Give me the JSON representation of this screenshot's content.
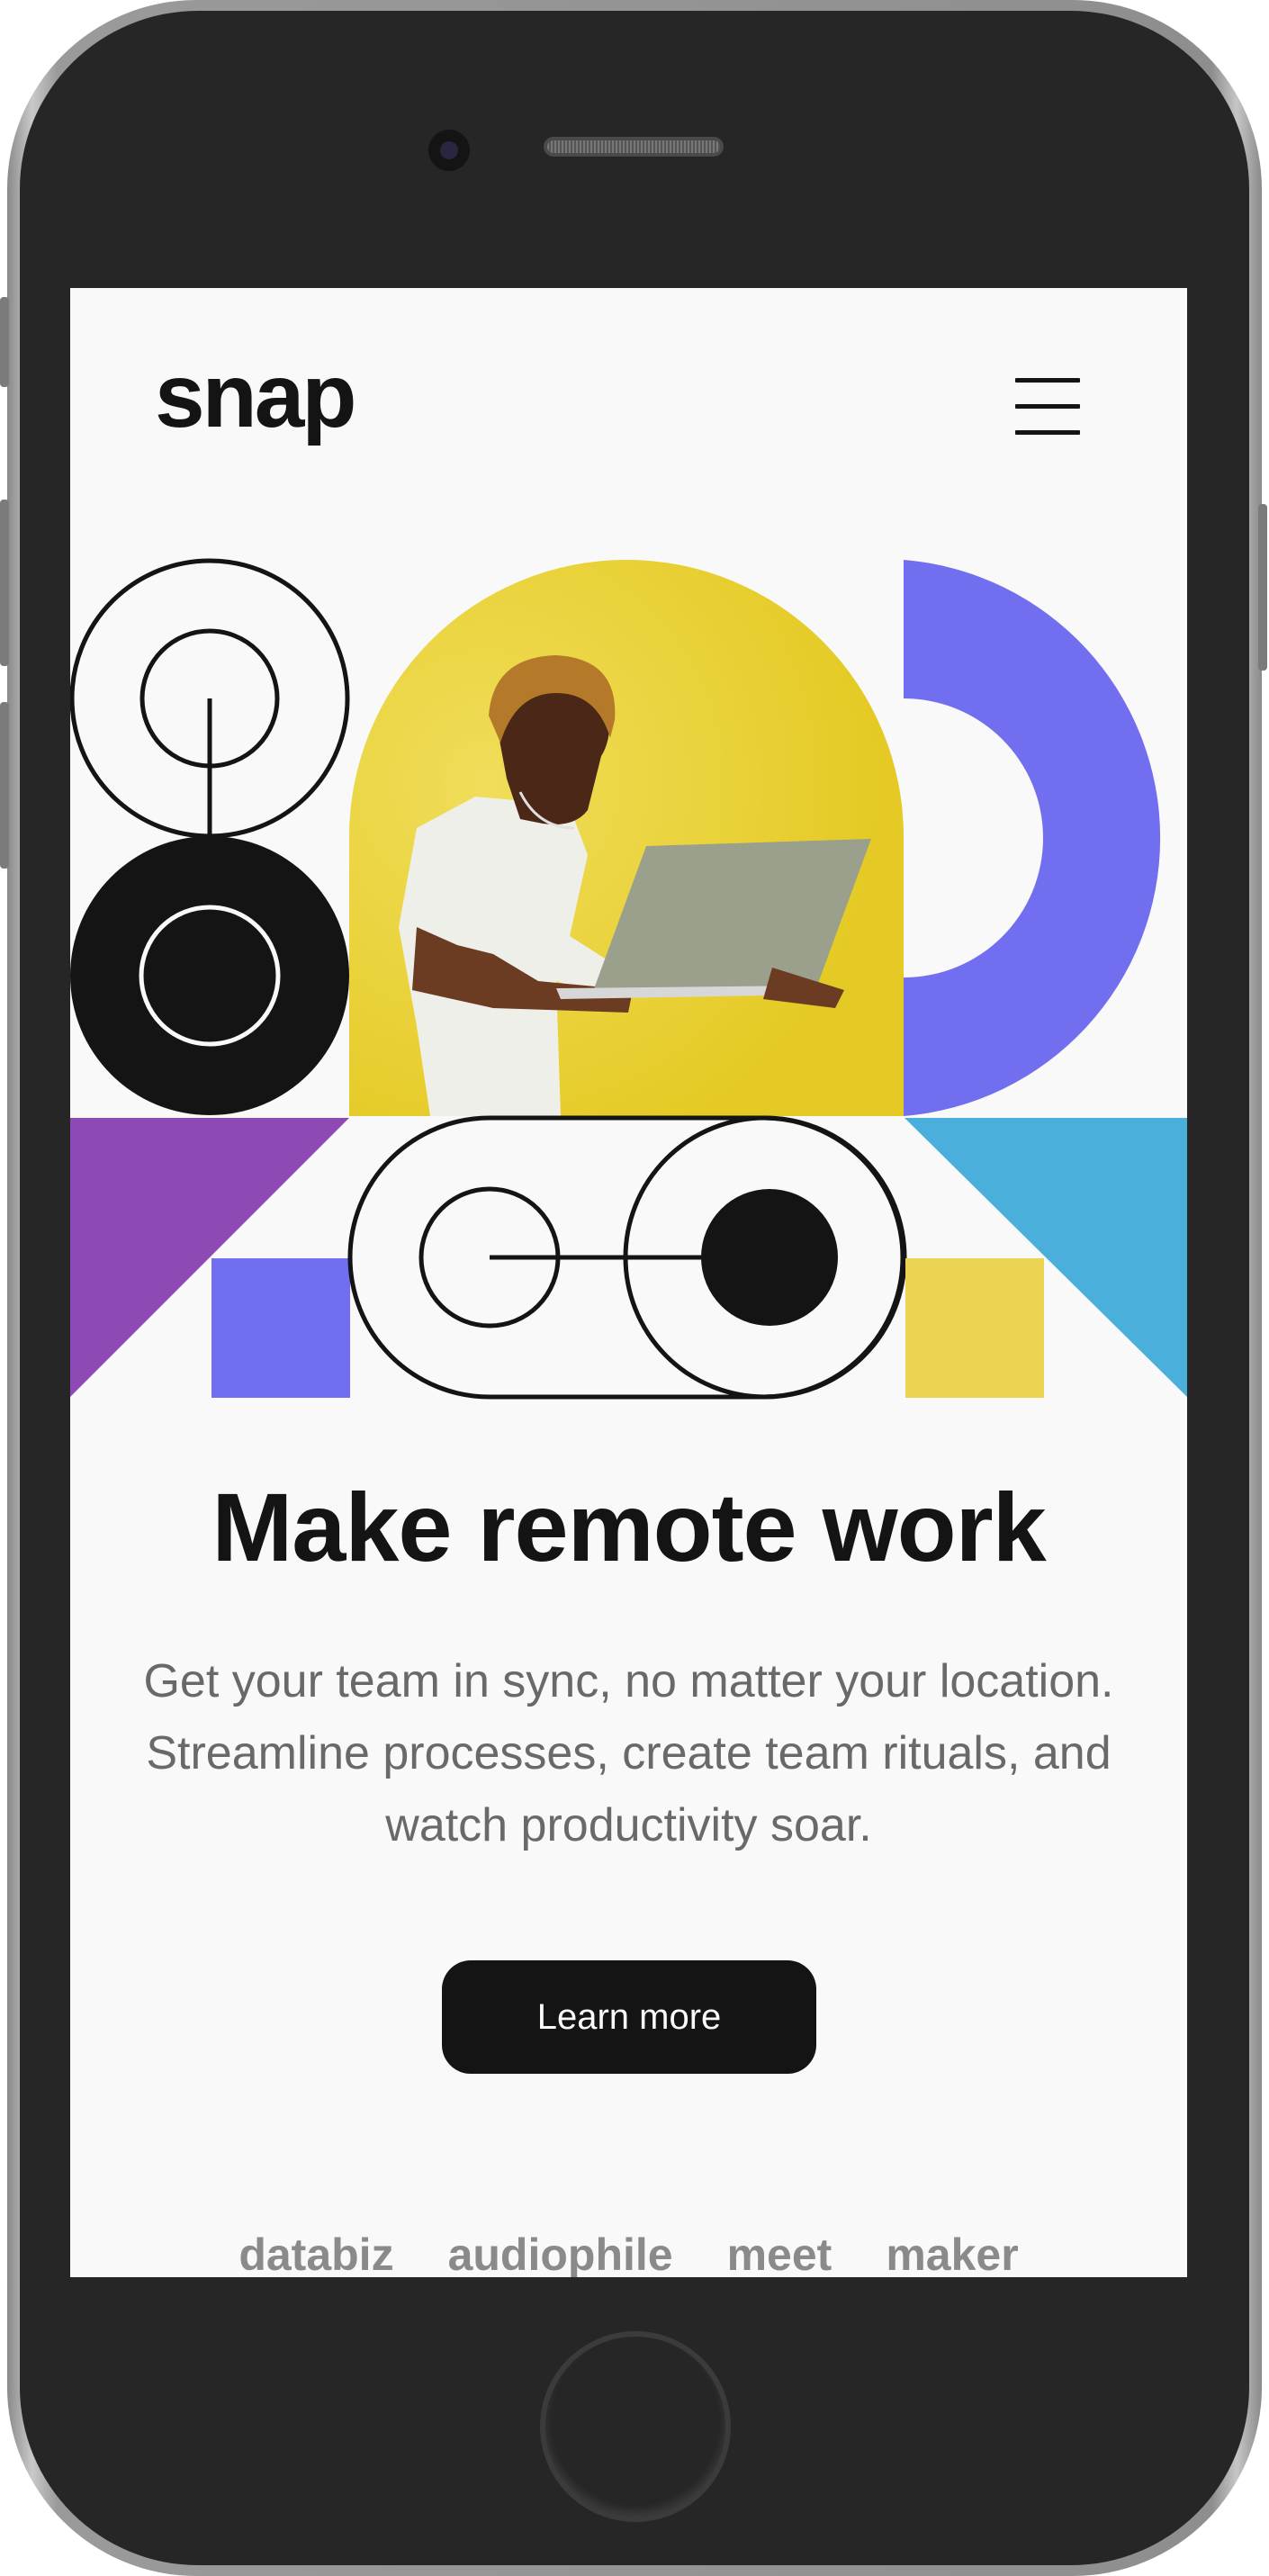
{
  "header": {
    "logo": "snap",
    "menu_icon": "hamburger-icon"
  },
  "hero": {
    "title": "Make remote work",
    "subtitle": "Get your team in sync, no matter your location. Streamline processes, create team rituals, and watch productivity soar.",
    "cta_label": "Learn more",
    "photo_description_icon": "person-with-laptop-image"
  },
  "clients": [
    "databiz",
    "audiophile",
    "meet",
    "maker"
  ],
  "colors": {
    "background": "#f9f9f9",
    "text_dark": "#141414",
    "text_muted": "#696969",
    "yellow": "#e8d02f",
    "purple": "#716fef",
    "violet": "#8d4ab5",
    "blue": "#4aafdb",
    "light_yellow": "#ecd452"
  }
}
